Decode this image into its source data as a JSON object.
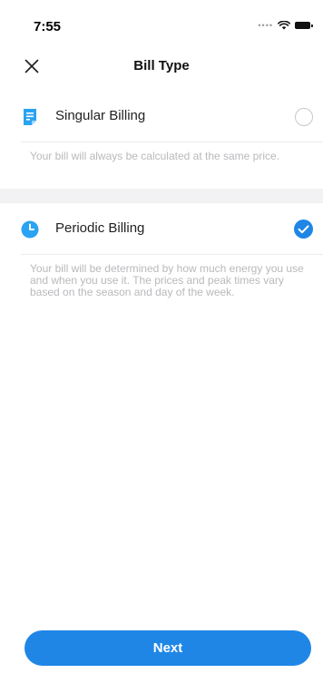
{
  "status_bar": {
    "time": "7:55",
    "icons": [
      "signal-dots-icon",
      "wifi-icon",
      "battery-icon"
    ]
  },
  "header": {
    "title": "Bill Type",
    "close_icon": "close-icon"
  },
  "options": [
    {
      "label": "Singular Billing",
      "icon": "document-icon",
      "selected": false,
      "description": "Your bill will always be calculated at the same price."
    },
    {
      "label": "Periodic Billing",
      "icon": "clock-icon",
      "selected": true,
      "description": "Your bill will be determined by how much energy you use and when you use it. The prices and peak times vary based on the season and day of the week."
    }
  ],
  "footer": {
    "next_label": "Next"
  },
  "colors": {
    "accent": "#1f86e6",
    "icon_blue": "#2aa3f3",
    "description_text": "#b9b9bd",
    "divider": "#f2f2f4"
  }
}
